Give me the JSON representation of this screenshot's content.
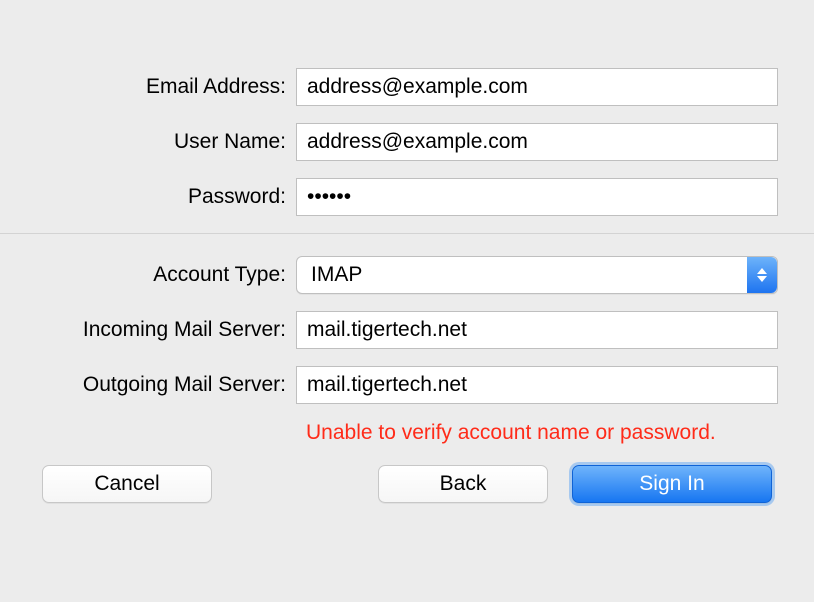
{
  "labels": {
    "email": "Email Address:",
    "username": "User Name:",
    "password": "Password:",
    "accountType": "Account Type:",
    "incoming": "Incoming Mail Server:",
    "outgoing": "Outgoing Mail Server:"
  },
  "values": {
    "email": "address@example.com",
    "username": "address@example.com",
    "password": "••••••",
    "accountType": "IMAP",
    "incoming": "mail.tigertech.net",
    "outgoing": "mail.tigertech.net"
  },
  "error": "Unable to verify account name or password.",
  "buttons": {
    "cancel": "Cancel",
    "back": "Back",
    "signIn": "Sign In"
  }
}
